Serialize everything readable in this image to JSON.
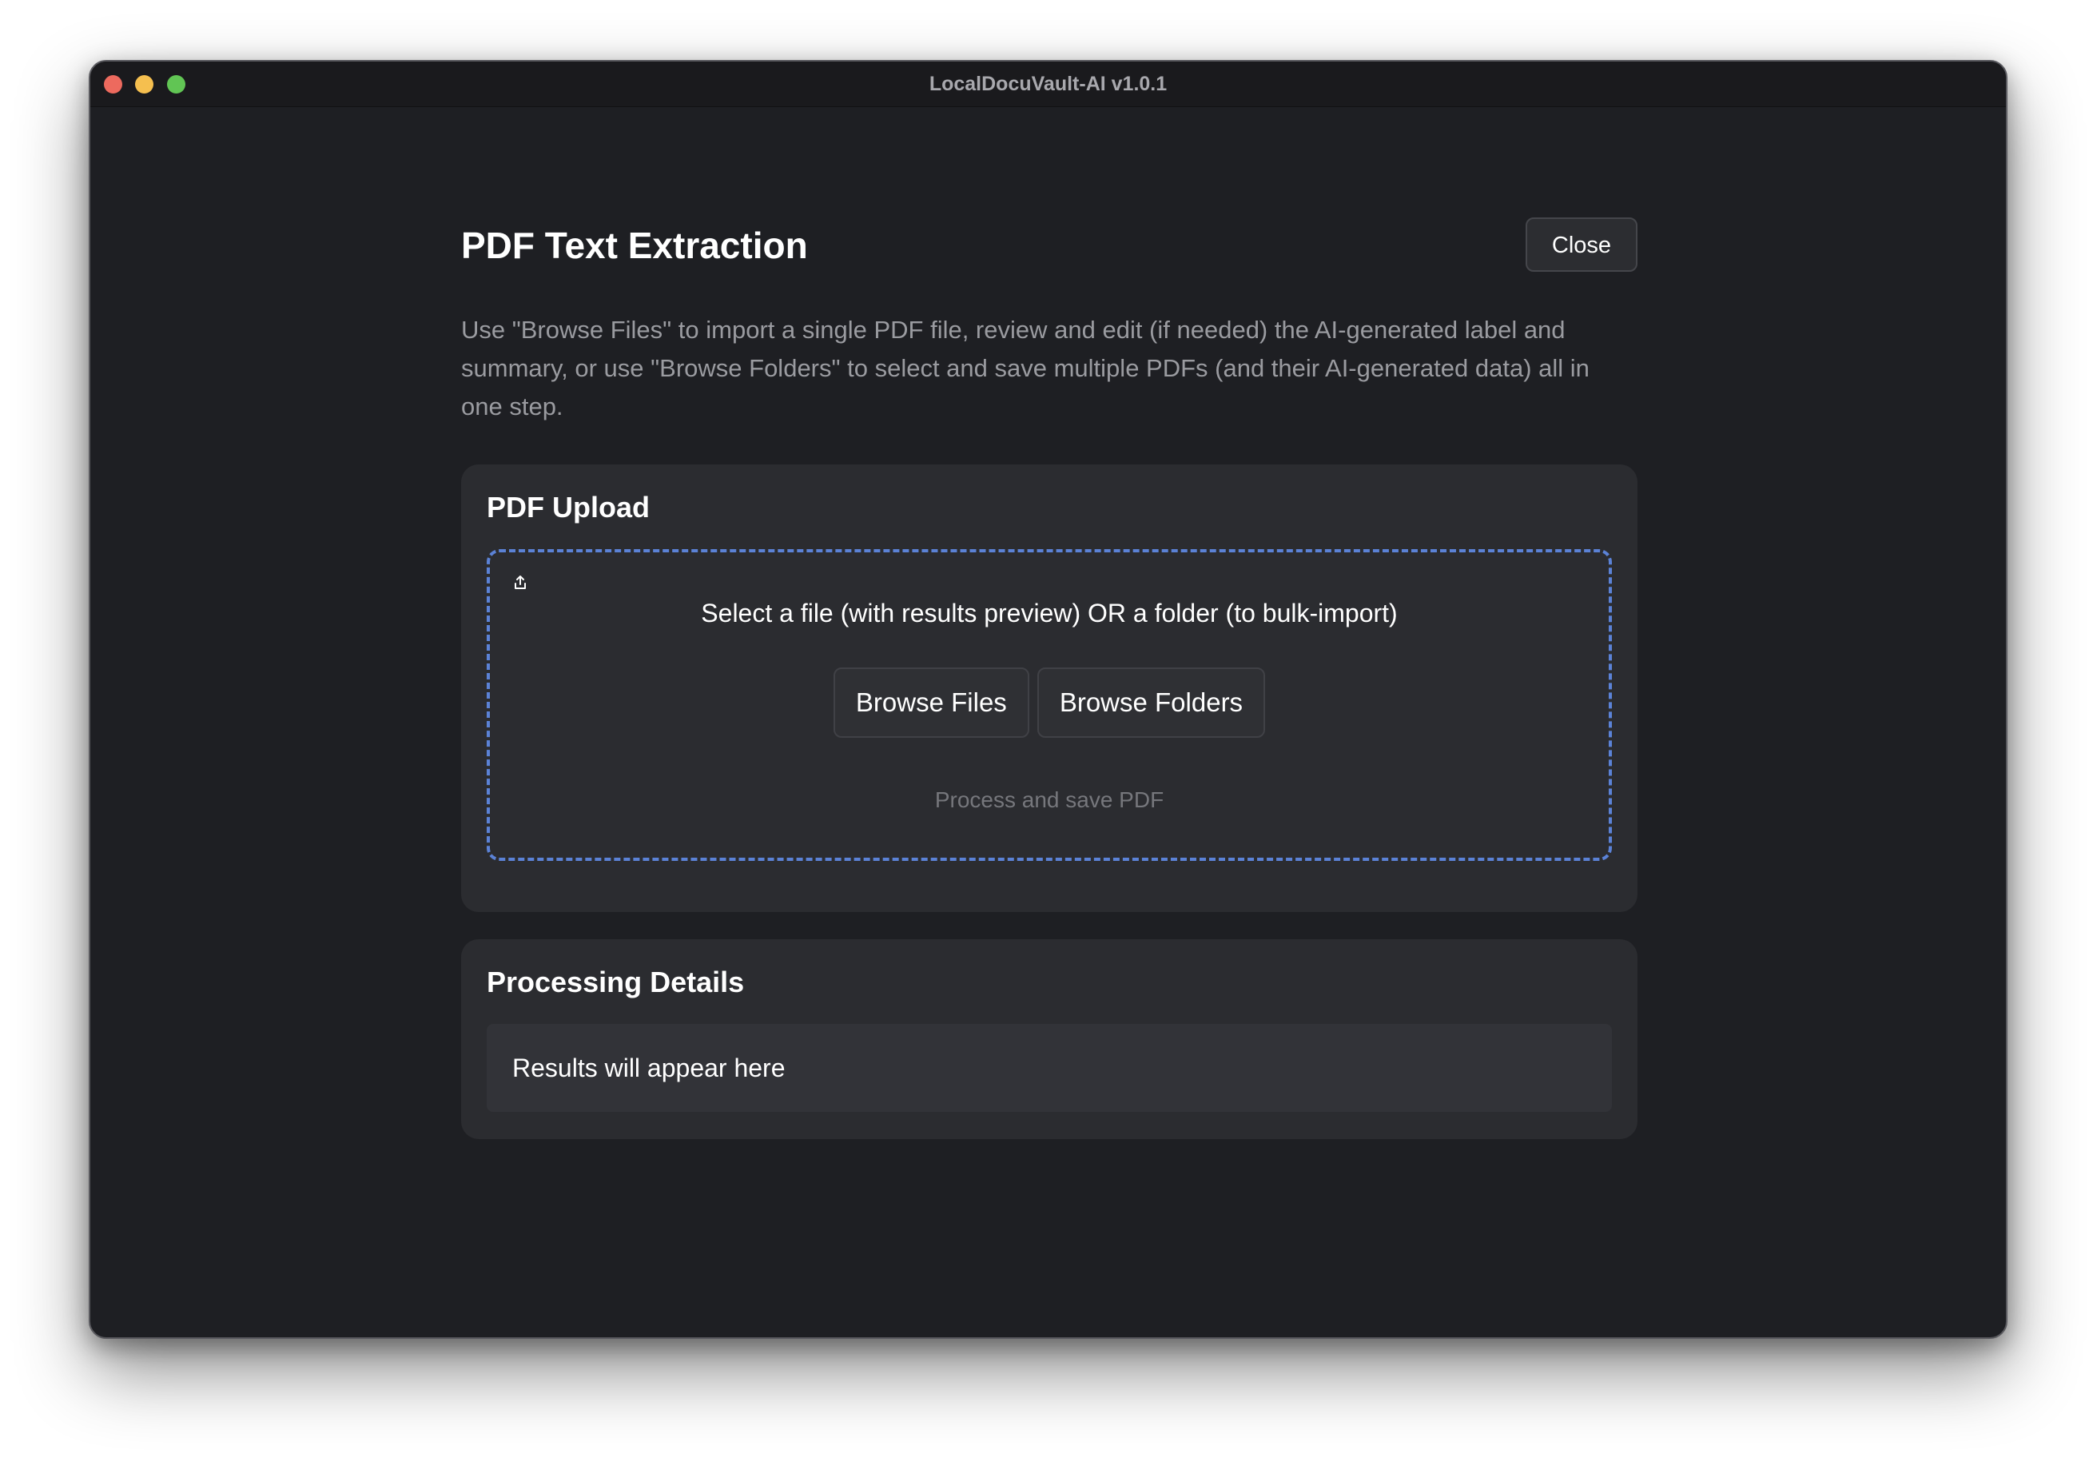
{
  "window": {
    "title": "LocalDocuVault-AI v1.0.1"
  },
  "header": {
    "title": "PDF Text Extraction",
    "close_label": "Close"
  },
  "description": "Use \"Browse Files\" to import a single PDF file, review and edit (if needed) the AI-generated label and summary, or use \"Browse Folders\" to select and save multiple PDFs (and their AI-generated data) all in one step.",
  "upload": {
    "title": "PDF Upload",
    "icon": "upload-icon",
    "prompt": "Select a file (with results preview) OR a folder (to bulk-import)",
    "browse_files_label": "Browse Files",
    "browse_folders_label": "Browse Folders",
    "process_label": "Process and save PDF",
    "dropzone_border_color": "#5b82d6"
  },
  "details": {
    "title": "Processing Details",
    "placeholder": "Results will appear here"
  },
  "colors": {
    "background": "#1e1f23",
    "card": "#2b2c30",
    "accent": "#5b82d6",
    "traffic_red": "#ed6a5e",
    "traffic_yellow": "#f5bf4f",
    "traffic_green": "#61c554"
  }
}
